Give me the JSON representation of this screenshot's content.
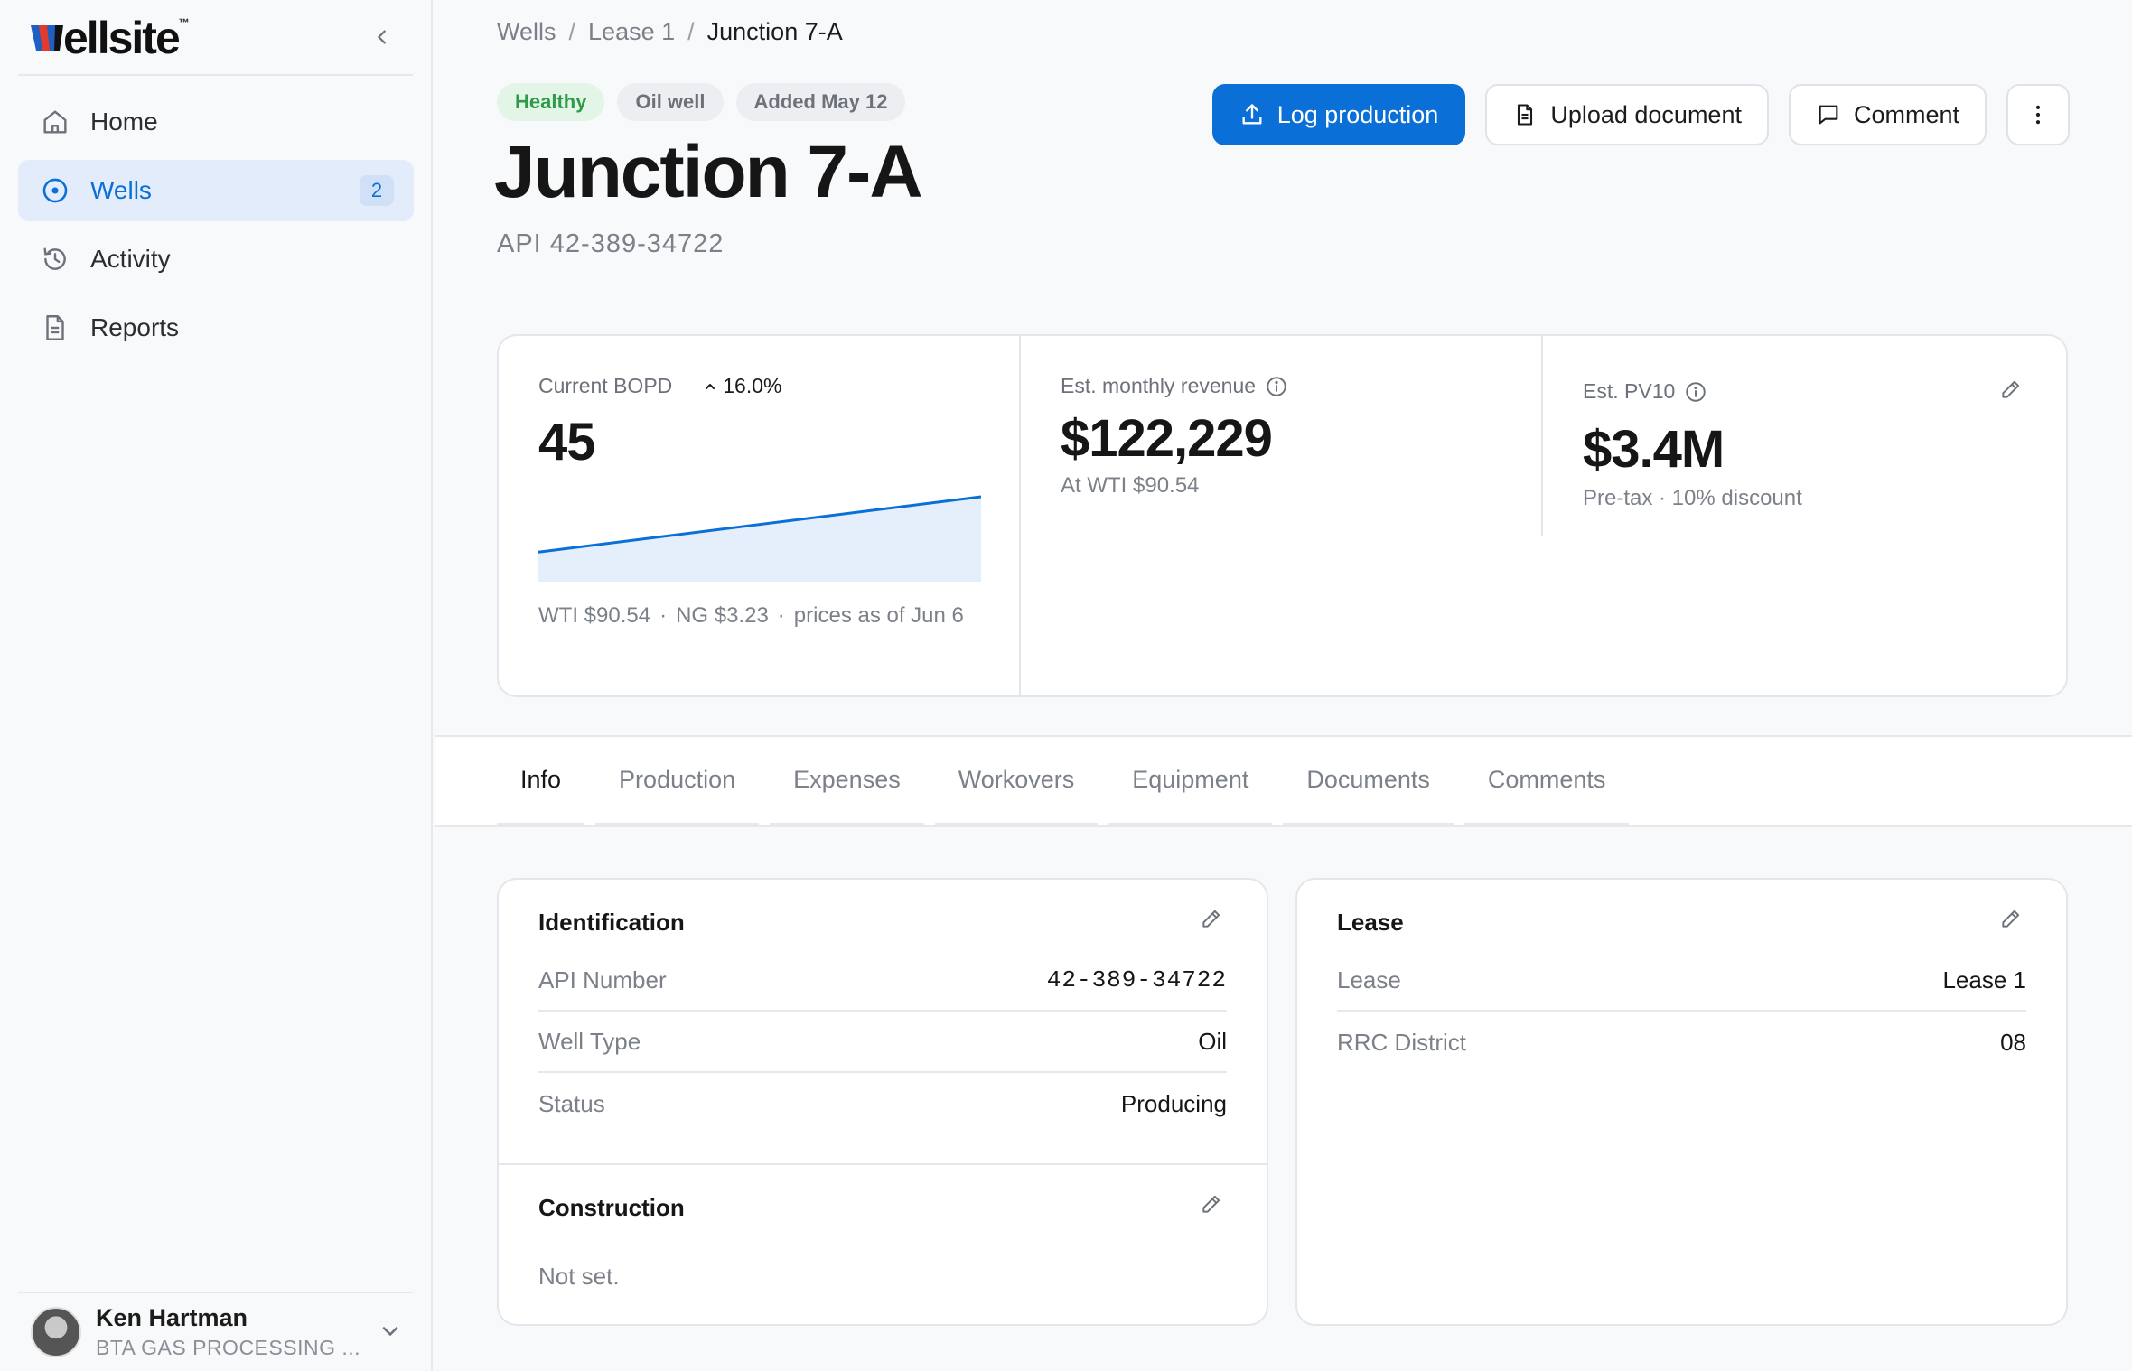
{
  "brand": {
    "name": "ellsite",
    "tm": "™"
  },
  "sidebar": {
    "items": [
      {
        "label": "Home",
        "icon": "home-icon"
      },
      {
        "label": "Wells",
        "icon": "target-icon",
        "badge": "2",
        "active": true
      },
      {
        "label": "Activity",
        "icon": "history-icon"
      },
      {
        "label": "Reports",
        "icon": "document-icon"
      }
    ],
    "user": {
      "name": "Ken Hartman",
      "org": "BTA GAS PROCESSING ..."
    }
  },
  "breadcrumb": {
    "items": [
      "Wells",
      "Lease 1"
    ],
    "current": "Junction 7-A",
    "sep": "/"
  },
  "chips": [
    "Healthy",
    "Oil well",
    "Added May 12"
  ],
  "well": {
    "name": "Junction 7-A",
    "api_sub": "API 42-389-34722"
  },
  "actions": {
    "log_production": "Log production",
    "upload_document": "Upload document",
    "comment": "Comment"
  },
  "stats": {
    "bopd": {
      "label": "Current BOPD",
      "change": "16.0%",
      "value": "45",
      "sparkline": [
        38.8,
        45
      ],
      "prices": {
        "wti": "WTI $90.54",
        "ng": "NG $3.23",
        "as_of": "prices as of Jun 6",
        "sep": "·"
      }
    },
    "revenue": {
      "label": "Est. monthly revenue",
      "value": "$122,229",
      "note": "At WTI $90.54"
    },
    "pv10": {
      "label": "Est. PV10",
      "value": "$3.4M",
      "note": "Pre-tax · 10% discount"
    }
  },
  "colors": {
    "accent": "#0a6fd6",
    "healthy": "#2e9b46",
    "spark_fill": "#e4effb"
  },
  "tabs": [
    "Info",
    "Production",
    "Expenses",
    "Workovers",
    "Equipment",
    "Documents",
    "Comments"
  ],
  "identification": {
    "title": "Identification",
    "rows": [
      {
        "k": "API Number",
        "v": "42-389-34722"
      },
      {
        "k": "Well Type",
        "v": "Oil"
      },
      {
        "k": "Status",
        "v": "Producing"
      }
    ]
  },
  "construction": {
    "title": "Construction",
    "empty": "Not set."
  },
  "lease": {
    "title": "Lease",
    "rows": [
      {
        "k": "Lease",
        "v": "Lease 1"
      },
      {
        "k": "RRC District",
        "v": "08"
      }
    ]
  }
}
